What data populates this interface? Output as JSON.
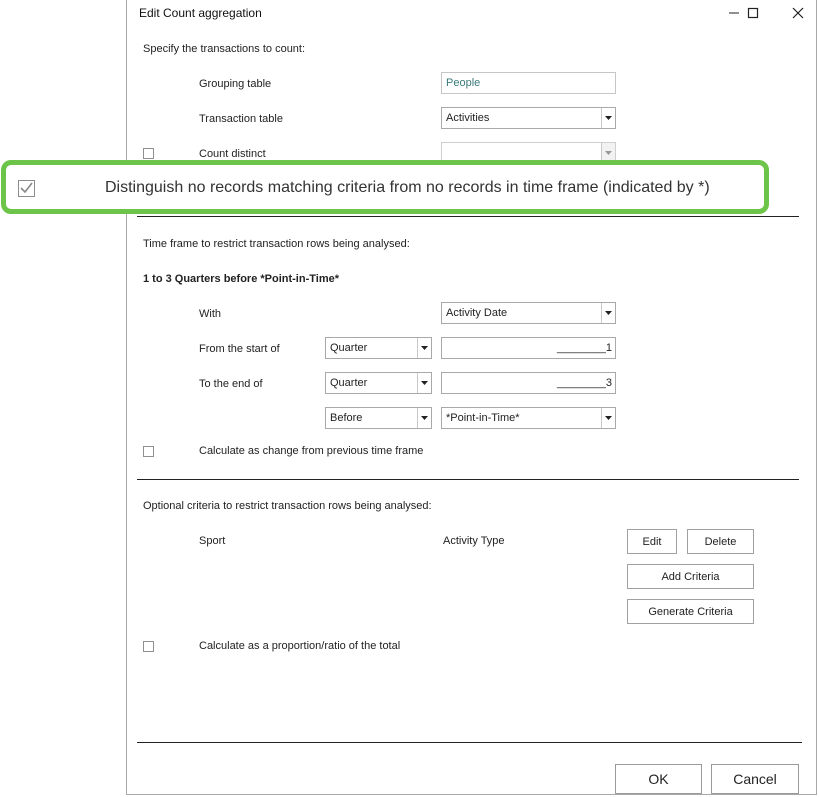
{
  "window": {
    "title": "Edit Count aggregation",
    "minimize_icon": "minimize-icon",
    "maximize_icon": "maximize-icon",
    "close_icon": "close-icon"
  },
  "transactions": {
    "heading": "Specify the transactions to count:",
    "grouping_table_label": "Grouping table",
    "grouping_table_value": "People",
    "transaction_table_label": "Transaction table",
    "transaction_table_value": "Activities",
    "count_distinct_label": "Count distinct",
    "count_distinct_value": ""
  },
  "callout": {
    "text": "Distinguish no records matching criteria from no records in time frame (indicated by *)",
    "checked": true,
    "highlight_color": "#6cc448"
  },
  "timeframe": {
    "heading": "Time frame to restrict transaction rows being analysed:",
    "summary": "1 to 3 Quarters before *Point-in-Time*",
    "with_label": "With",
    "with_value": "Activity Date",
    "from_label": "From the start of",
    "from_unit": "Quarter",
    "from_value": "________1",
    "to_label": "To the end of",
    "to_unit": "Quarter",
    "to_value": "________3",
    "relation": "Before",
    "point_in_time": "*Point-in-Time*",
    "change_label": "Calculate as change from previous time frame"
  },
  "criteria": {
    "heading": "Optional criteria to restrict transaction rows being analysed:",
    "col_sport": "Sport",
    "col_activity_type": "Activity Type",
    "edit_label": "Edit",
    "delete_label": "Delete",
    "add_label": "Add Criteria",
    "generate_label": "Generate Criteria",
    "proportion_label": "Calculate as a proportion/ratio of the total"
  },
  "footer": {
    "ok_label": "OK",
    "cancel_label": "Cancel"
  }
}
